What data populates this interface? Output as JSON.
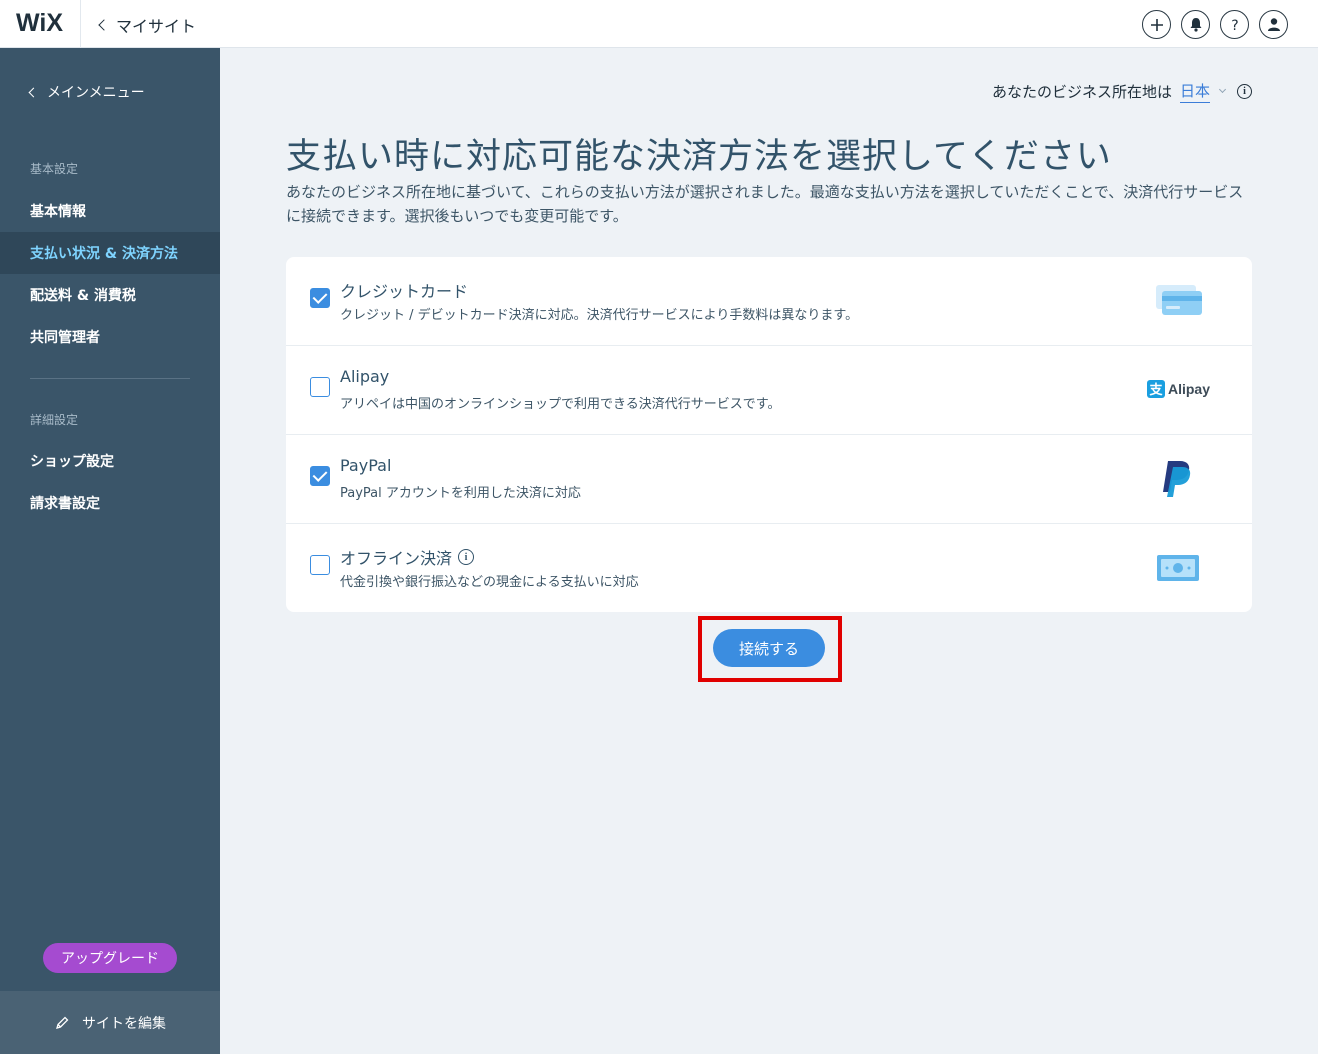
{
  "topbar": {
    "logo": "WiX",
    "back_label": "マイサイト"
  },
  "sidebar": {
    "back_label": "メインメニュー",
    "section_basic": "基本設定",
    "items_basic": [
      {
        "label": "基本情報"
      },
      {
        "label": "支払い状況 & 決済方法",
        "active": true
      },
      {
        "label": "配送料 & 消費税"
      },
      {
        "label": "共同管理者"
      }
    ],
    "section_advanced": "詳細設定",
    "items_advanced": [
      {
        "label": "ショップ設定"
      },
      {
        "label": "請求書設定"
      }
    ],
    "upgrade_label": "アップグレード",
    "edit_site_label": "サイトを編集"
  },
  "main": {
    "location_label": "あなたのビジネス所在地は",
    "location_value": "日本",
    "title": "支払い時に対応可能な決済方法を選択してください",
    "description": "あなたのビジネス所在地に基づいて、これらの支払い方法が選択されました。最適な支払い方法を選択していただくことで、決済代行サービスに接続できます。選択後もいつでも変更可能です。",
    "methods": [
      {
        "title": "クレジットカード",
        "desc": "クレジット / デビットカード決済に対応。決済代行サービスにより手数料は異なります。",
        "checked": true,
        "icon": "credit-card-icon"
      },
      {
        "title": "Alipay",
        "desc": "アリペイは中国のオンラインショップで利用できる決済代行サービスです。",
        "checked": false,
        "icon": "alipay-logo",
        "logo_text": "Alipay"
      },
      {
        "title": "PayPal",
        "desc": "PayPal アカウントを利用した決済に対応",
        "checked": true,
        "icon": "paypal-logo"
      },
      {
        "title": "オフライン決済",
        "desc": "代金引換や銀行振込などの現金による支払いに対応",
        "checked": false,
        "icon": "cash-icon"
      }
    ],
    "connect_label": "接続する"
  },
  "colors": {
    "accent": "#3b8de0",
    "sidebar_bg": "#3a5569",
    "upgrade": "#a54bd0",
    "highlight_frame": "#e00000"
  }
}
